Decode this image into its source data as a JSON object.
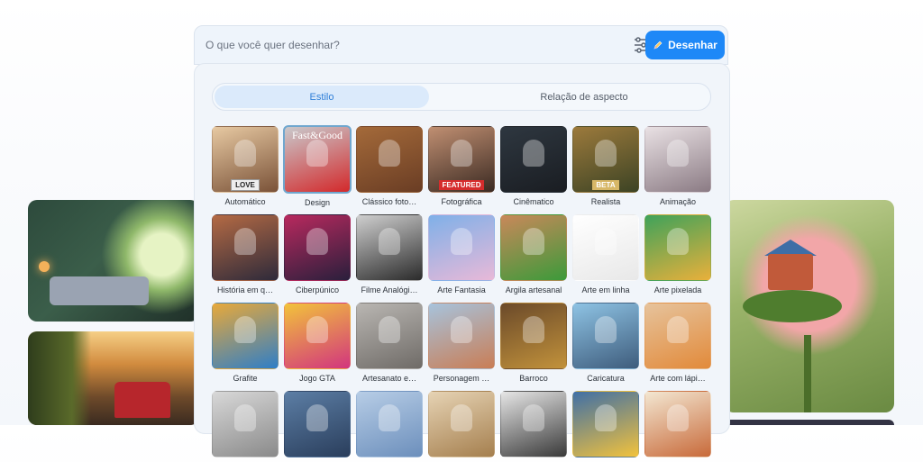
{
  "search": {
    "placeholder": "O que você quer desenhar?",
    "button_label": "Desenhar"
  },
  "tabs": [
    {
      "label": "Estilo",
      "active": true
    },
    {
      "label": "Relação de aspecto",
      "active": false
    }
  ],
  "styles": [
    {
      "label": "Automático",
      "badge": "LOVE",
      "colors": [
        "#e7c9a2",
        "#7a5238"
      ]
    },
    {
      "label": "Design",
      "cover_text": "Fast&Good",
      "selected": true,
      "colors": [
        "#c9c9cc",
        "#d3292b"
      ]
    },
    {
      "label": "Clássico foto…",
      "colors": [
        "#a46a3a",
        "#6a3d24"
      ]
    },
    {
      "label": "Fotográfica",
      "badge": "FEATURED",
      "colors": [
        "#c08f72",
        "#3b2a22"
      ]
    },
    {
      "label": "Cinêmatico",
      "colors": [
        "#2e3740",
        "#1a1d22"
      ]
    },
    {
      "label": "Realista",
      "badge": "BETA",
      "colors": [
        "#9c7a3c",
        "#3c4324"
      ]
    },
    {
      "label": "Animação",
      "colors": [
        "#e9e1e4",
        "#8b7b84"
      ]
    },
    {
      "label": "História em q…",
      "colors": [
        "#b46a44",
        "#2e2a3a"
      ]
    },
    {
      "label": "Ciberpúnico",
      "colors": [
        "#b8295e",
        "#2a1f3c"
      ]
    },
    {
      "label": "Filme Analógi…",
      "colors": [
        "#cfcfcf",
        "#2b2b2b"
      ]
    },
    {
      "label": "Arte Fantasia",
      "colors": [
        "#7fb0e8",
        "#e8b9d8"
      ]
    },
    {
      "label": "Argila artesanal",
      "colors": [
        "#c9885a",
        "#3c9a3a"
      ]
    },
    {
      "label": "Arte em linha",
      "colors": [
        "#ffffff",
        "#e8e8e8"
      ]
    },
    {
      "label": "Arte pixelada",
      "colors": [
        "#3fa25a",
        "#e9b03b"
      ]
    },
    {
      "label": "Grafite",
      "colors": [
        "#e8a93a",
        "#2f7ec7"
      ]
    },
    {
      "label": "Jogo GTA",
      "colors": [
        "#f2c33b",
        "#d2357e"
      ]
    },
    {
      "label": "Artesanato e…",
      "colors": [
        "#b9b6b2",
        "#6f6b67"
      ]
    },
    {
      "label": "Personagem …",
      "colors": [
        "#a7c3dc",
        "#c97d55"
      ]
    },
    {
      "label": "Barroco",
      "colors": [
        "#6b4a2a",
        "#c2923b"
      ]
    },
    {
      "label": "Caricatura",
      "colors": [
        "#8ec3e4",
        "#3e5c7c"
      ]
    },
    {
      "label": "Arte com lápi…",
      "colors": [
        "#e6c39c",
        "#e28a3a"
      ]
    },
    {
      "label": "",
      "colors": [
        "#d8d8d8",
        "#8a8a8a"
      ]
    },
    {
      "label": "",
      "colors": [
        "#5c7ea5",
        "#2a3e5c"
      ]
    },
    {
      "label": "",
      "colors": [
        "#b7cde6",
        "#6c8fbc"
      ]
    },
    {
      "label": "",
      "colors": [
        "#e6d3b4",
        "#a57f4e"
      ]
    },
    {
      "label": "",
      "colors": [
        "#e6e6e6",
        "#3a3a3a"
      ]
    },
    {
      "label": "",
      "colors": [
        "#3f6fa6",
        "#f2c23c"
      ]
    },
    {
      "label": "",
      "colors": [
        "#f3e7d2",
        "#c86a3a"
      ]
    }
  ],
  "colors": {
    "accent": "#1e88f7",
    "active_tab_bg": "#dbeafb",
    "active_tab_text": "#2f7fd8"
  }
}
